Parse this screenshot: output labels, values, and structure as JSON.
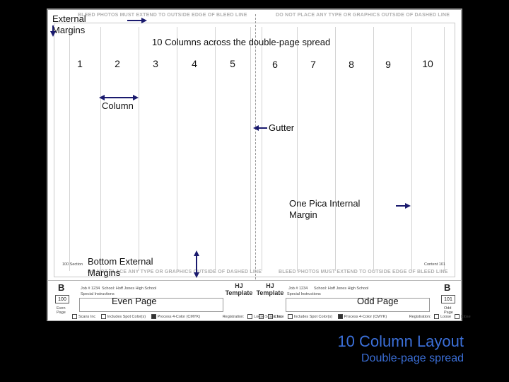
{
  "spread": {
    "bleed_left": "BLEED PHOTOS MUST EXTEND TO OUTSIDE EDGE OF BLEED LINE",
    "bleed_right": "DO NOT PLACE ANY TYPE OR GRAPHICS OUTSIDE OF DASHED LINE",
    "bottom_left": "DO NOT PLACE ANY TYPE OR GRAPHICS OUTSIDE OF DASHED LINE",
    "bottom_right": "BLEED PHOTOS MUST EXTEND TO OUTSIDE EDGE OF BLEED LINE",
    "left_section": "100 Section",
    "right_content": "Content 101"
  },
  "column_numbers": [
    "1",
    "2",
    "3",
    "4",
    "5",
    "6",
    "7",
    "8",
    "9",
    "10"
  ],
  "annotations": {
    "external_margins": "External Margins",
    "columns_title": "10 Columns across the double-page spread",
    "column": "Column",
    "gutter": "Gutter",
    "internal_margin": "One Pica Internal Margin",
    "bottom_margins": "Bottom External Margins",
    "even_page": "Even Page",
    "odd_page": "Odd Page"
  },
  "footer": {
    "left_letter": "B",
    "right_letter": "B",
    "left_page": "100",
    "right_page": "101",
    "even_label": "Even Page",
    "odd_label": "Odd Page",
    "job": "Job # 1234",
    "school": "School: Hoff Jones High School",
    "special": "Special Instructions",
    "hj_line1": "HJ",
    "hj_line2": "Template",
    "left_checks": [
      "Scans Inc",
      "Includes Spot Color(s)",
      "Process 4-Color (CMYK)"
    ],
    "left_reg": [
      "Registration:",
      "Loose",
      "Close"
    ],
    "right_checks": [
      "Scans Inc",
      "Includes Spot Color(s)",
      "Process 4-Color (CMYK)"
    ],
    "right_reg": [
      "Registration:",
      "Loose",
      "Close"
    ]
  },
  "caption": {
    "title": "10 Column Layout",
    "subtitle": "Double-page spread"
  },
  "colors": {
    "background": "#000000",
    "page": "#ffffff",
    "caption": "#3b6fd8",
    "arrows": "#1a1a6e"
  }
}
